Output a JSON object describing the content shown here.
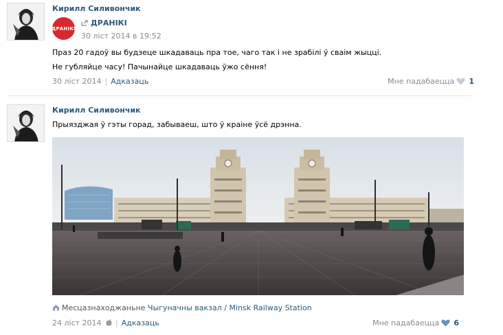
{
  "post1": {
    "author": "Кирилл Силивончик",
    "repost": {
      "logo_text": "ДРАНІКІ",
      "name": "ДРАНІКІ",
      "date": "30 ліст 2014 в 19:52"
    },
    "text_line1": "Праз 20 гадоў вы будзеце шкадаваць пра тое, чаго так і не зрабілі ў сваім жыцці.",
    "text_line2": "Не губляйце часу! Пачынайце шкадаваць ўжо сёння!",
    "date": "30 ліст 2014",
    "reply_label": "Адказаць",
    "like_label": "Мне падабаецца",
    "like_count": "1"
  },
  "post2": {
    "author": "Кирилл Силивончик",
    "text": "Прыязджая ў гэты горад, забываеш, што ў краіне ўсё дрэнна.",
    "place_label": "Месцазнаходжаньне",
    "place_name": "Чыгуначны вакзал / Minsk Railway Station",
    "date": "24 ліст 2014",
    "reply_label": "Адказаць",
    "like_label": "Мне падабаецца",
    "like_count": "6"
  },
  "colors": {
    "link": "#2b587a",
    "muted": "#8a8a8a",
    "brand_red": "#d9272e",
    "heart_grey": "#c5ced8",
    "heart_active": "#6d8fb3"
  }
}
